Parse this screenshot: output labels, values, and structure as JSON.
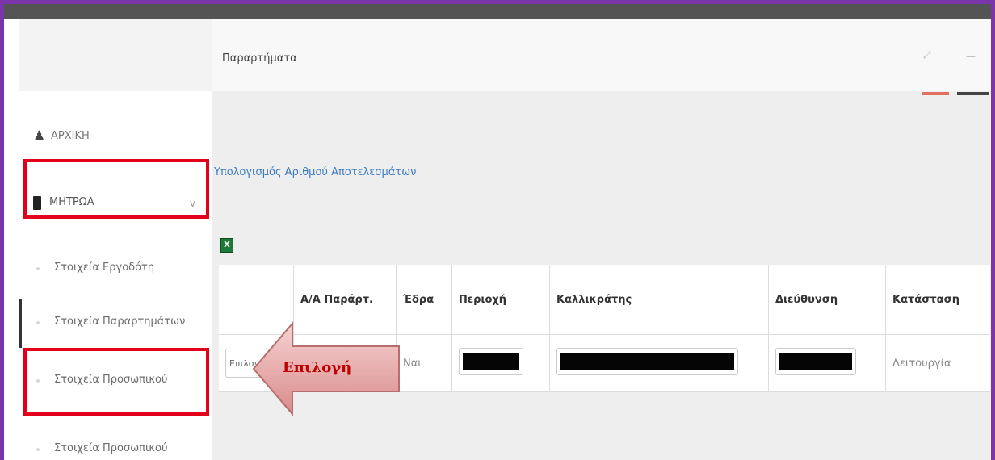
{
  "sidebar": {
    "home_label": "ΑΡΧΙΚΗ",
    "mitroa_label": "ΜΗΤΡΩΑ",
    "sub_items": [
      {
        "label": "Στοιχεία Εργοδότη"
      },
      {
        "label": "Στοιχεία Παραρτημάτων"
      },
      {
        "label": "Στοιχεία Προσωπικού"
      },
      {
        "label": "Στοιχεία Προσωπικού"
      }
    ]
  },
  "main": {
    "title": "Παραρτήματα",
    "calc_link": "Υπολογισμός Αριθμού Αποτελεσμάτων",
    "excel_label": "X"
  },
  "table": {
    "headers": [
      "",
      "Α/Α Παράρτ.",
      "Έδρα",
      "Περιοχή",
      "Καλλικράτης",
      "Διεύθυνση",
      "Κατάσταση"
    ],
    "row": {
      "select": "Επιλογή",
      "aa": "",
      "edra": "Ναι",
      "status": "Λειτουργία"
    }
  },
  "annotation": {
    "arrow_label": "Επιλογή",
    "arrow_fill": "#f1b8b8",
    "arrow_text_color": "#c00000",
    "highlight_color": "#e3001b"
  }
}
